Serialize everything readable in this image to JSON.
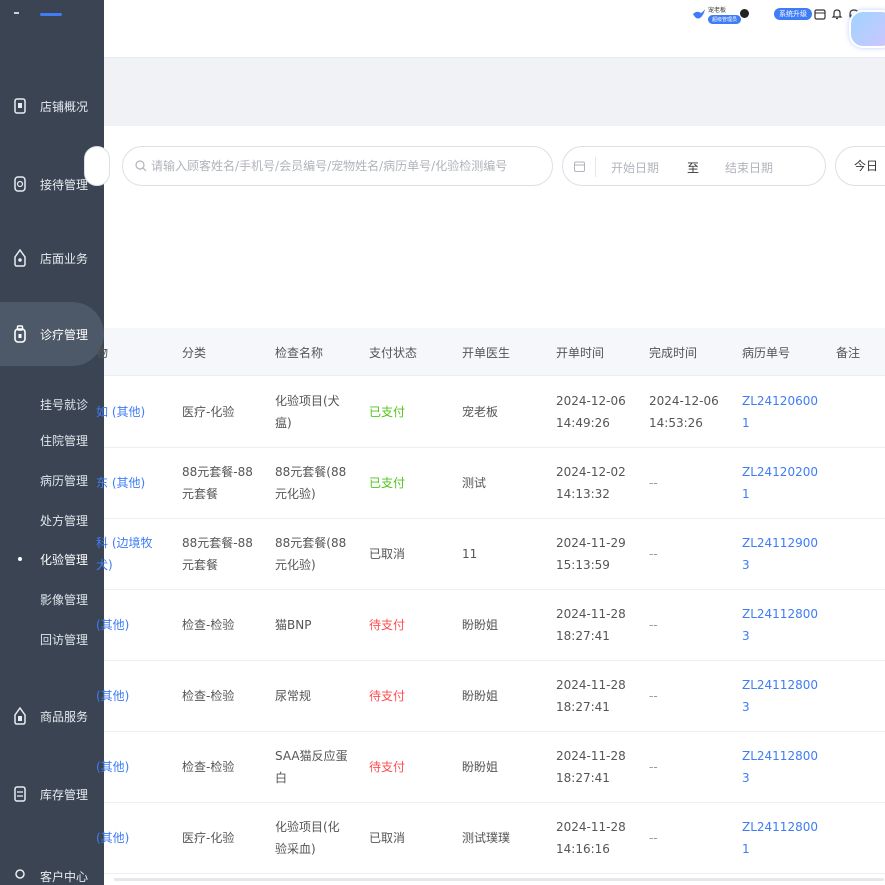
{
  "sidebar": {
    "nav": [
      {
        "label": "店铺概况",
        "icon": "store-icon"
      },
      {
        "label": "接待管理",
        "icon": "reception-icon"
      },
      {
        "label": "店面业务",
        "icon": "business-icon"
      },
      {
        "label": "诊疗管理",
        "icon": "medical-icon"
      }
    ],
    "sub_items": [
      {
        "label": "挂号就诊"
      },
      {
        "label": "住院管理"
      },
      {
        "label": "病历管理"
      },
      {
        "label": "处方管理"
      },
      {
        "label": "化验管理"
      },
      {
        "label": "影像管理"
      },
      {
        "label": "回访管理"
      }
    ],
    "nav_bottom": [
      {
        "label": "商品服务",
        "icon": "goods-icon"
      },
      {
        "label": "库存管理",
        "icon": "inventory-icon"
      },
      {
        "label": "客户中心",
        "icon": "customer-icon"
      }
    ]
  },
  "header": {
    "user_name": "宠老板",
    "user_tag": "超级管理员",
    "upgrade_label": "系统升级",
    "icons": [
      "calendar-icon",
      "bell-icon",
      "headset-icon"
    ]
  },
  "filters": {
    "search_placeholder": "请输入顾客姓名/手机号/会员编号/宠物姓名/病历单号/化验检测编号",
    "date_start": "开始日期",
    "date_to": "至",
    "date_end": "结束日期",
    "today_label": "今日"
  },
  "table": {
    "columns": [
      "物",
      "分类",
      "检查名称",
      "支付状态",
      "开单医生",
      "开单时间",
      "完成时间",
      "病历单号",
      "备注"
    ],
    "rows": [
      {
        "pet": [
          "如 (其他)",
          ""
        ],
        "category": [
          "医疗-化验",
          ""
        ],
        "exam": [
          "化验项目(犬",
          "瘟)"
        ],
        "status": "已支付",
        "status_type": "paid",
        "doctor": "宠老板",
        "open_time": [
          "2024-12-06",
          "14:49:26"
        ],
        "done_time": [
          "2024-12-06",
          "14:53:26"
        ],
        "record": [
          "ZL24120600",
          "1"
        ]
      },
      {
        "pet": [
          "东 (其他)",
          ""
        ],
        "category": [
          "88元套餐-88",
          "元套餐"
        ],
        "exam": [
          "88元套餐(88",
          "元化验)"
        ],
        "status": "已支付",
        "status_type": "paid",
        "doctor": "测试",
        "open_time": [
          "2024-12-02",
          "14:13:32"
        ],
        "done_time": [
          "--",
          ""
        ],
        "record": [
          "ZL24120200",
          "1"
        ]
      },
      {
        "pet": [
          "科 (边境牧",
          "犬)"
        ],
        "category": [
          "88元套餐-88",
          "元套餐"
        ],
        "exam": [
          "88元套餐(88",
          "元化验)"
        ],
        "status": "已取消",
        "status_type": "cancel",
        "doctor": "11",
        "open_time": [
          "2024-11-29",
          "15:13:59"
        ],
        "done_time": [
          "--",
          ""
        ],
        "record": [
          "ZL24112900",
          "3"
        ]
      },
      {
        "pet": [
          "(其他)",
          ""
        ],
        "category": [
          "检查-检验",
          ""
        ],
        "exam": [
          "猫BNP",
          ""
        ],
        "status": "待支付",
        "status_type": "unpaid",
        "doctor": "盼盼姐",
        "open_time": [
          "2024-11-28",
          "18:27:41"
        ],
        "done_time": [
          "--",
          ""
        ],
        "record": [
          "ZL24112800",
          "3"
        ]
      },
      {
        "pet": [
          "(其他)",
          ""
        ],
        "category": [
          "检查-检验",
          ""
        ],
        "exam": [
          "尿常规",
          ""
        ],
        "status": "待支付",
        "status_type": "unpaid",
        "doctor": "盼盼姐",
        "open_time": [
          "2024-11-28",
          "18:27:41"
        ],
        "done_time": [
          "--",
          ""
        ],
        "record": [
          "ZL24112800",
          "3"
        ]
      },
      {
        "pet": [
          "(其他)",
          ""
        ],
        "category": [
          "检查-检验",
          ""
        ],
        "exam": [
          "SAA猫反应蛋",
          "白"
        ],
        "status": "待支付",
        "status_type": "unpaid",
        "doctor": "盼盼姐",
        "open_time": [
          "2024-11-28",
          "18:27:41"
        ],
        "done_time": [
          "--",
          ""
        ],
        "record": [
          "ZL24112800",
          "3"
        ]
      },
      {
        "pet": [
          "(其他)",
          ""
        ],
        "category": [
          "医疗-化验",
          ""
        ],
        "exam": [
          "化验项目(化",
          "验采血)"
        ],
        "status": "已取消",
        "status_type": "cancel",
        "doctor": "测试璞璞",
        "open_time": [
          "2024-11-28",
          "14:16:16"
        ],
        "done_time": [
          "--",
          ""
        ],
        "record": [
          "ZL24112800",
          "1"
        ]
      }
    ]
  },
  "colors": {
    "sidebar_bg": "#3a4452",
    "accent": "#3f7cf6",
    "paid": "#52c41a",
    "unpaid": "#ff4d4f"
  }
}
